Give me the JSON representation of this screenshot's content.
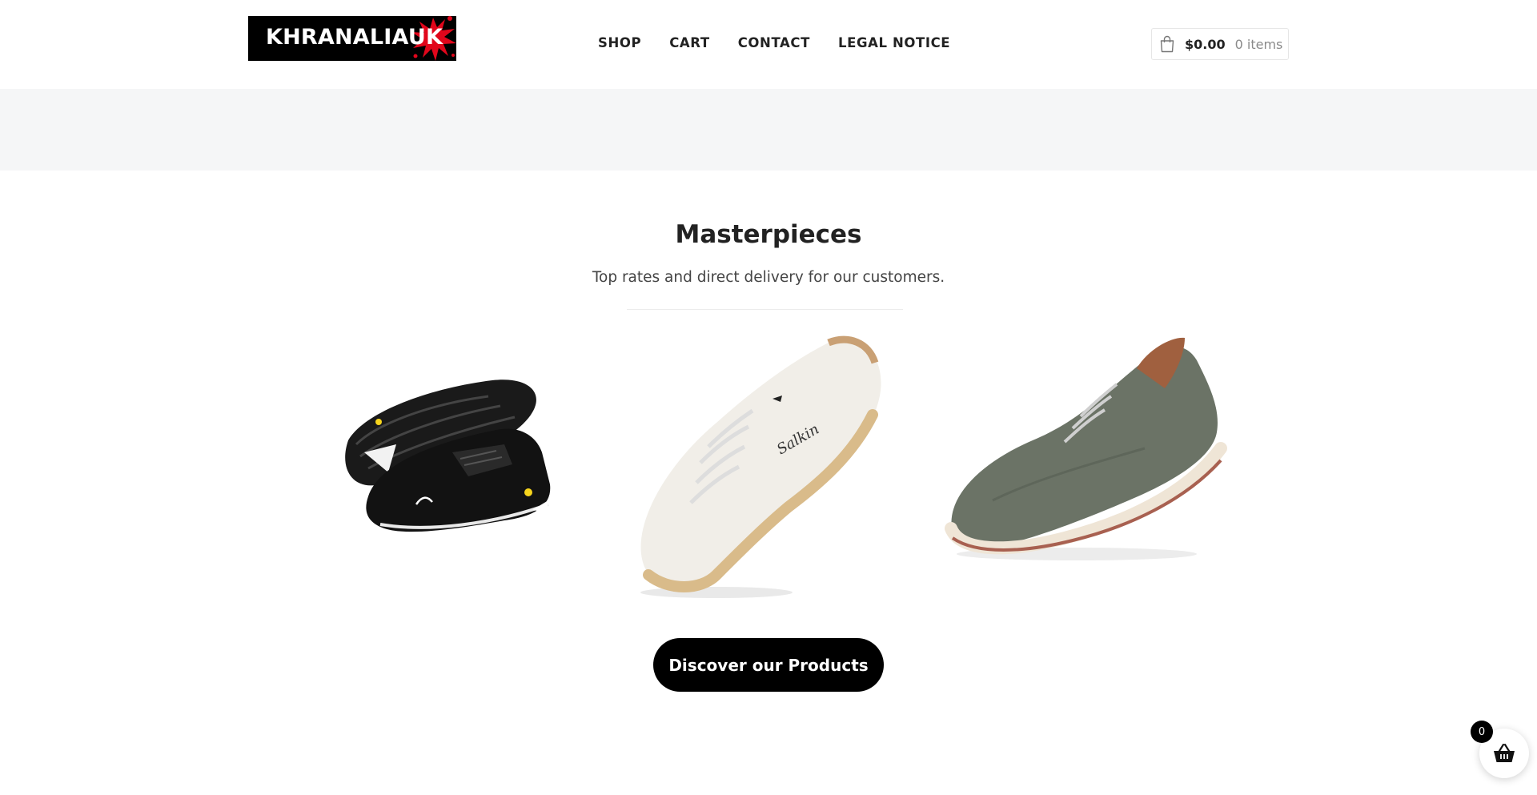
{
  "brand": {
    "logo_text": "KHRANALIAUK"
  },
  "nav": {
    "items": [
      {
        "label": "SHOP"
      },
      {
        "label": "CART"
      },
      {
        "label": "CONTACT"
      },
      {
        "label": "LEGAL NOTICE"
      }
    ]
  },
  "header_cart": {
    "icon": "shopping-bag-icon",
    "price": "$0.00",
    "count": "0 items"
  },
  "section": {
    "title": "Masterpieces",
    "subtitle": "Top rates and direct delivery for our customers."
  },
  "products": [
    {
      "image": "black-sneaker"
    },
    {
      "image": "white-leather-shoe"
    },
    {
      "image": "grey-knit-shoe"
    }
  ],
  "cta": {
    "label": "Discover our Products"
  },
  "floating_cart": {
    "icon": "basket-icon",
    "badge": "0"
  },
  "colors": {
    "accent": "#000000",
    "banner": "#f5f6f7",
    "logo_splat": "#e1061b"
  }
}
